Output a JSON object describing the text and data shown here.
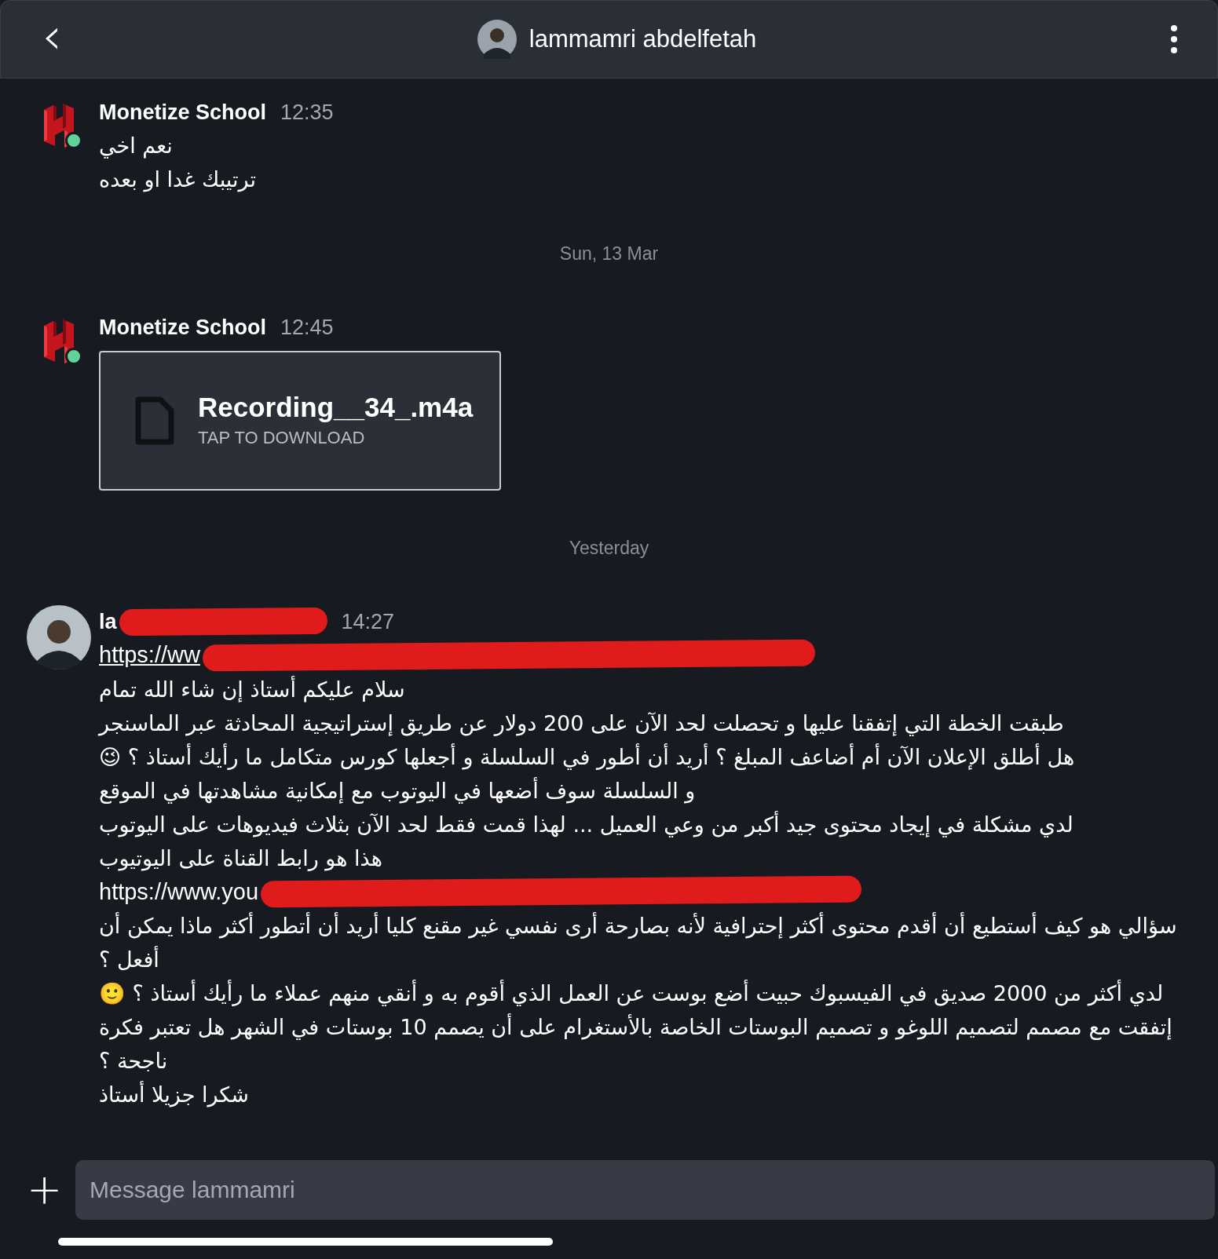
{
  "header": {
    "back": "‹",
    "title": "lammamri abdelfetah"
  },
  "items": [
    {
      "kind": "message",
      "sender": "Monetize School",
      "time": "12:35",
      "avatar": {
        "kind": "logo"
      },
      "online": true,
      "lines": [
        {
          "kind": "text",
          "text": "نعم اخي"
        },
        {
          "kind": "text",
          "text": "ترتيبك غدا او بعده"
        }
      ]
    },
    {
      "kind": "date",
      "text": "Sun, 13 Mar"
    },
    {
      "kind": "message",
      "sender": "Monetize School",
      "time": "12:45",
      "avatar": {
        "kind": "logo"
      },
      "online": true,
      "lines": [
        {
          "kind": "file",
          "name": "Recording__34_.m4a",
          "action": "TAP TO DOWNLOAD"
        }
      ]
    },
    {
      "kind": "date",
      "text": "Yesterday"
    },
    {
      "kind": "message",
      "sender": "la",
      "sender_redacted": true,
      "time": "14:27",
      "avatar": {
        "kind": "person"
      },
      "online": false,
      "lines": [
        {
          "kind": "link",
          "text": "https://ww",
          "redacted": true
        },
        {
          "kind": "text",
          "text": "سلام عليكم أستاذ إن شاء الله تمام"
        },
        {
          "kind": "text",
          "text": "طبقت الخطة التي إتفقنا عليها و تحصلت لحد الآن على 200 دولار عن طريق إستراتيجية المحادثة عبر الماسنجر"
        },
        {
          "kind": "text",
          "text": "هل أطلق الإعلان الآن أم أضاعف المبلغ ؟ أريد أن أطور في السلسلة و أجعلها كورس متكامل ما رأيك أستاذ ؟ 😉"
        },
        {
          "kind": "text",
          "text": "و السلسلة سوف أضعها في اليوتوب مع إمكانية مشاهدتها في الموقع"
        },
        {
          "kind": "text",
          "text": "لدي مشكلة في إيجاد محتوى جيد أكبر من وعي العميل ... لهذا قمت فقط لحد الآن بثلاث فيديوهات على اليوتوب"
        },
        {
          "kind": "text",
          "text": "هذا هو رابط القناة على اليوتيوب"
        },
        {
          "kind": "plain",
          "text": "https://www.you",
          "redacted": true
        },
        {
          "kind": "text",
          "text": "سؤالي هو كيف أستطيع أن أقدم محتوى أكثر إحترافية لأنه بصارحة أرى نفسي غير مقنع كليا أريد أن أتطور أكثر ماذا يمكن أن أفعل ؟"
        },
        {
          "kind": "text",
          "text": "لدي أكثر من 2000 صديق في الفيسبوك حبيت أضع بوست عن العمل الذي أقوم به  و أنقي منهم عملاء ما رأيك أستاذ ؟ 🙂"
        },
        {
          "kind": "text",
          "text": "إتفقت مع مصمم لتصميم اللوغو و تصميم البوستات الخاصة بالأستغرام على أن يصمم 10 بوستات في الشهر هل تعتبر فكرة ناجحة ؟"
        },
        {
          "kind": "text",
          "text": "شكرا جزيلا أستاذ"
        }
      ]
    }
  ],
  "composer": {
    "plus": "+",
    "placeholder": "Message lammamri"
  }
}
